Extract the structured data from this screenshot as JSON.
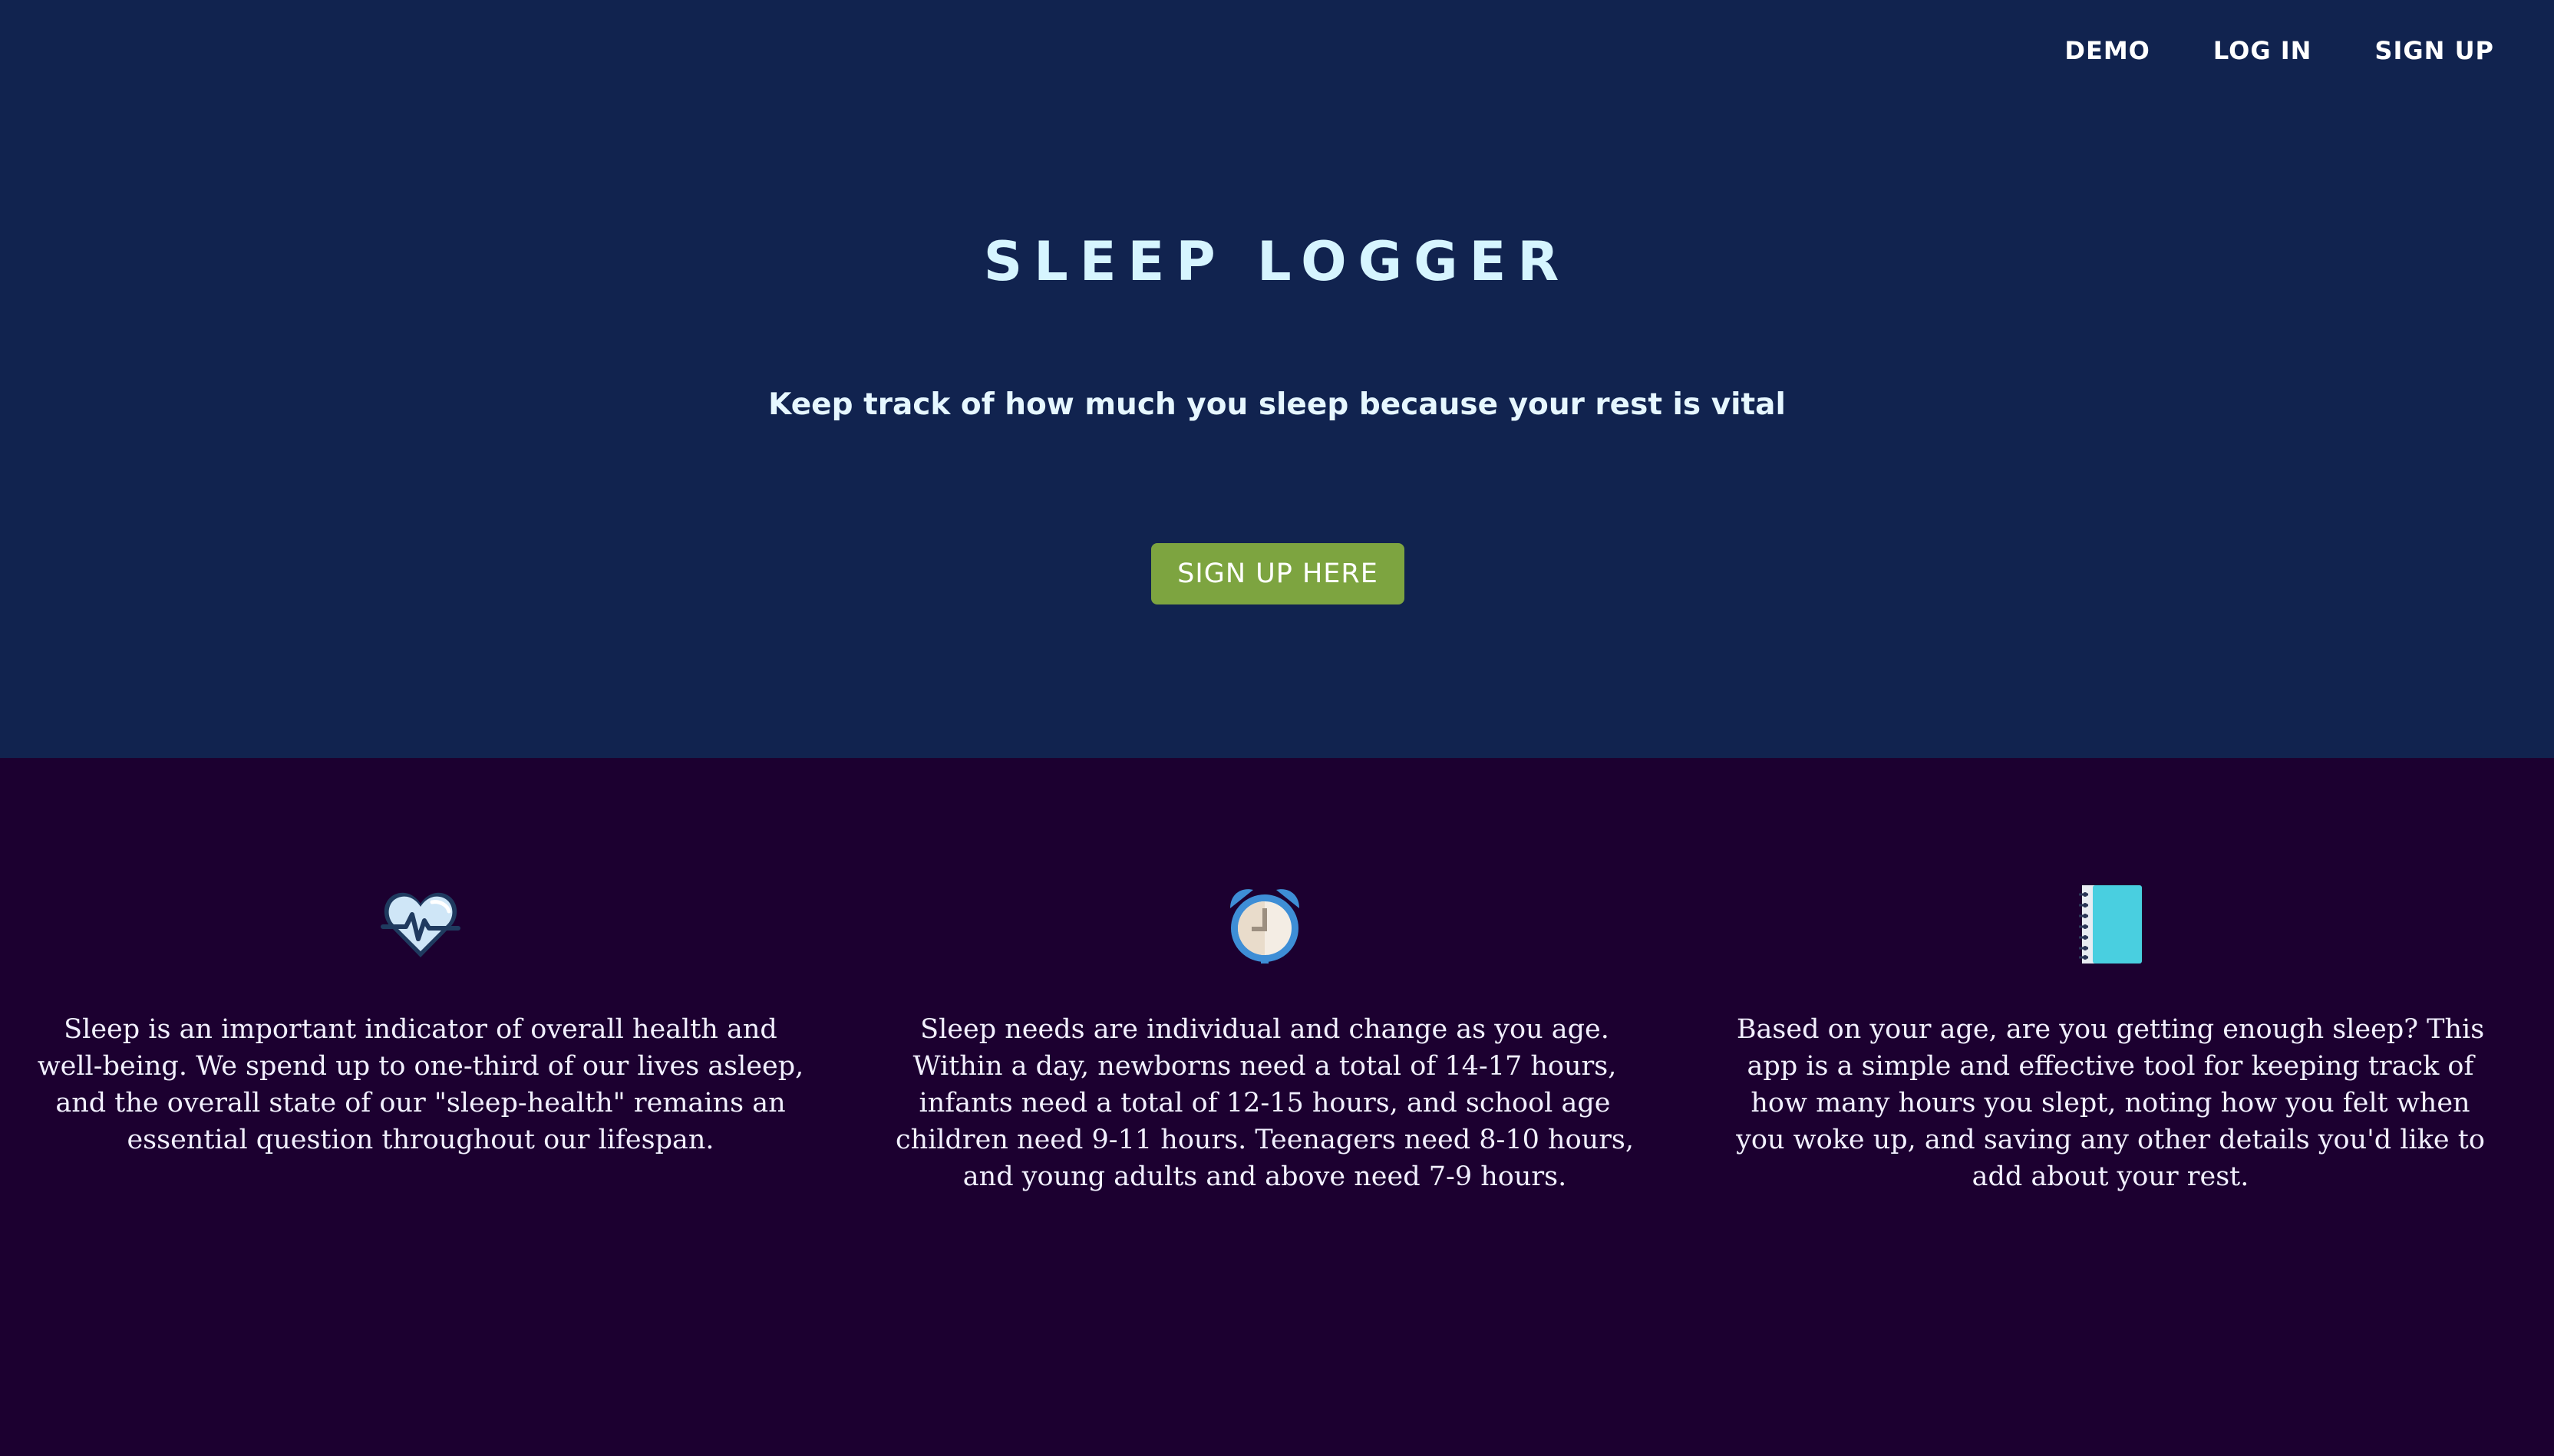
{
  "nav": {
    "items": [
      "DEMO",
      "LOG IN",
      "SIGN UP"
    ]
  },
  "hero": {
    "title": "SLEEP LOGGER",
    "subtitle": "Keep track of how much you sleep because your rest is vital",
    "cta_label": "SIGN UP HERE"
  },
  "features": [
    {
      "icon": "heart-pulse-icon",
      "text": "Sleep is an important indicator of overall health and well-being. We spend up to one-third of our lives asleep, and the overall state of our \"sleep-health\" remains an essential question throughout our lifespan."
    },
    {
      "icon": "alarm-clock-icon",
      "text": "Sleep needs are individual and change as you age. Within a day, newborns need a total of 14-17 hours, infants need a total of 12-15 hours, and school age children need 9-11 hours. Teenagers need 8-10 hours, and young adults and above need 7-9 hours."
    },
    {
      "icon": "notebook-icon",
      "text": "Based on your age, are you getting enough sleep? This app is a simple and effective tool for keeping track of how many hours you slept, noting how you felt when you woke up, and saving any other details you'd like to add about your rest."
    }
  ],
  "colors": {
    "hero_bg": "#11234f",
    "features_bg": "#1c0030",
    "cta_bg": "#7da440",
    "title": "#d6f5ff"
  }
}
